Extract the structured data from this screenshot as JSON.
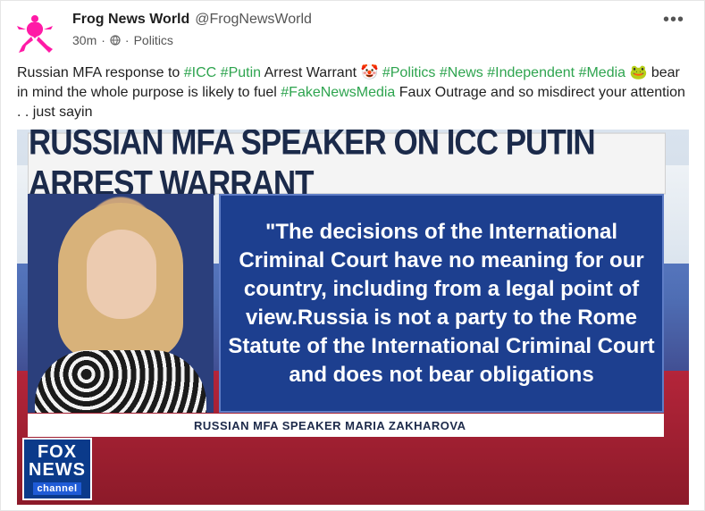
{
  "author": {
    "name": "Frog News World",
    "handle": "@FrogNewsWorld",
    "time": "30m",
    "category": "Politics",
    "avatar_icon": "frog-avatar-icon",
    "avatar_color": "#ff1aa6"
  },
  "post": {
    "segments": [
      {
        "text": "Russian MFA response to ",
        "type": "text"
      },
      {
        "text": "#ICC",
        "type": "tag"
      },
      {
        "text": " ",
        "type": "text"
      },
      {
        "text": "#Putin",
        "type": "tag"
      },
      {
        "text": " Arrest Warrant 🤡 ",
        "type": "text"
      },
      {
        "text": "#Politics",
        "type": "tag"
      },
      {
        "text": " ",
        "type": "text"
      },
      {
        "text": "#News",
        "type": "tag"
      },
      {
        "text": " ",
        "type": "text"
      },
      {
        "text": "#Independent",
        "type": "tag"
      },
      {
        "text": " ",
        "type": "text"
      },
      {
        "text": "#Media",
        "type": "tag"
      },
      {
        "text": " 🐸 bear in mind the whole purpose is likely to fuel ",
        "type": "text"
      },
      {
        "text": "#FakeNewsMedia",
        "type": "tag"
      },
      {
        "text": " Faux Outrage and so misdirect your attention . . just sayin",
        "type": "text"
      }
    ],
    "tag_color": "#2ea44f"
  },
  "media": {
    "headline": "RUSSIAN MFA SPEAKER ON ICC PUTIN ARREST WARRANT",
    "quote": "\"The decisions of the International Criminal Court have no meaning for our country, including from a legal point of view.Russia is not a party to the Rome Statute of the International Criminal Court and does not bear obligations",
    "caption": "RUSSIAN MFA SPEAKER MARIA ZAKHAROVA",
    "logo_word_1": "FOX",
    "logo_word_2": "NEWS",
    "logo_channel": "channel"
  },
  "menu_icon": "more-options-icon",
  "visibility_icon": "globe-icon"
}
